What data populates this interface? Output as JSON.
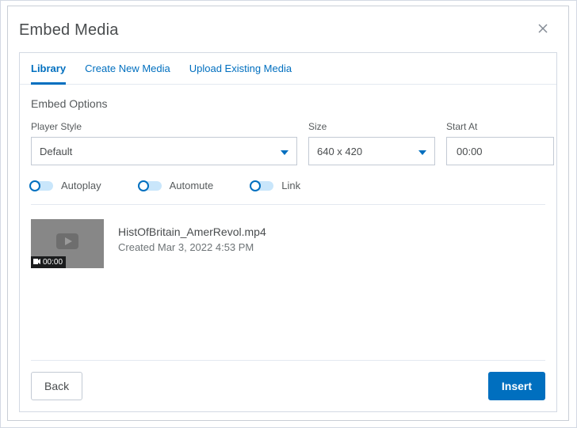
{
  "modal": {
    "title": "Embed Media"
  },
  "tabs": [
    {
      "label": "Library",
      "active": true
    },
    {
      "label": "Create New Media",
      "active": false
    },
    {
      "label": "Upload Existing Media",
      "active": false
    }
  ],
  "section_title": "Embed Options",
  "fields": {
    "player_style": {
      "label": "Player Style",
      "value": "Default"
    },
    "size": {
      "label": "Size",
      "value": "640 x 420"
    },
    "start_at": {
      "label": "Start At",
      "value": "00:00"
    }
  },
  "toggles": {
    "autoplay": {
      "label": "Autoplay",
      "on": false
    },
    "automute": {
      "label": "Automute",
      "on": false
    },
    "link": {
      "label": "Link",
      "on": false
    }
  },
  "media_item": {
    "filename": "HistOfBritain_AmerRevol.mp4",
    "created": "Created Mar 3, 2022 4:53 PM",
    "duration": "00:00"
  },
  "buttons": {
    "back": "Back",
    "insert": "Insert"
  }
}
